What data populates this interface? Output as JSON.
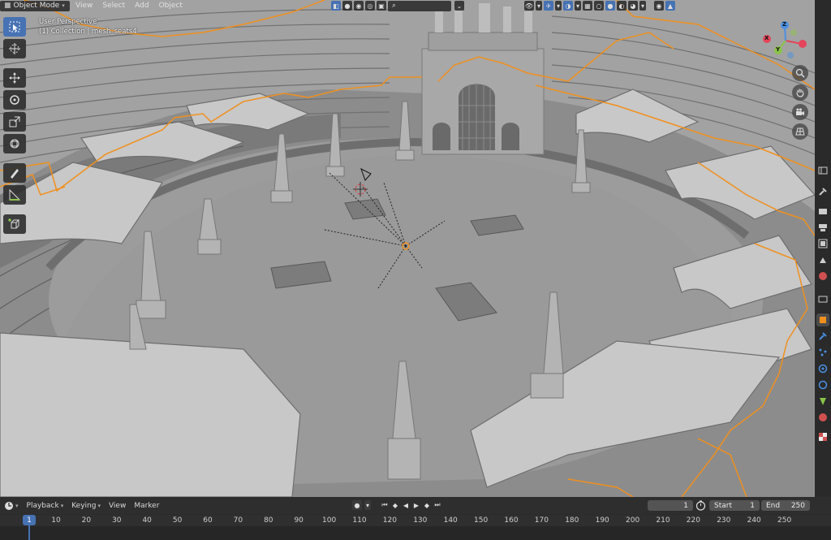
{
  "header": {
    "mode_label": "Object Mode",
    "menus": [
      "View",
      "Select",
      "Add",
      "Object"
    ]
  },
  "viewport": {
    "perspective_label": "User Perspective",
    "collection_label": "(1) Collection | mesh_seats4"
  },
  "gizmo": {
    "x_label": "X",
    "y_label": "Y",
    "z_label": "Z",
    "x_color": "#e5455a",
    "y_color": "#8bc34a",
    "z_color": "#4a90e2"
  },
  "toolbar": {
    "tools": [
      "select-box-icon",
      "cursor-icon",
      "move-icon",
      "rotate-icon",
      "scale-icon",
      "transform-icon",
      "annotate-icon",
      "measure-icon",
      "add-cube-icon"
    ]
  },
  "timeline": {
    "menus": [
      "Playback",
      "Keying",
      "View",
      "Marker"
    ],
    "current_frame": "1",
    "start_label": "Start",
    "start_value": "1",
    "end_label": "End",
    "end_value": "250",
    "ticks": [
      "1",
      "10",
      "20",
      "30",
      "40",
      "50",
      "60",
      "70",
      "80",
      "90",
      "100",
      "110",
      "120",
      "130",
      "140",
      "150",
      "160",
      "170",
      "180",
      "190",
      "200",
      "210",
      "220",
      "230",
      "240",
      "250"
    ]
  },
  "colors": {
    "accent": "#4772b3",
    "selection_outline": "#f0901e",
    "viewport_bg": "#8f8f8f"
  }
}
